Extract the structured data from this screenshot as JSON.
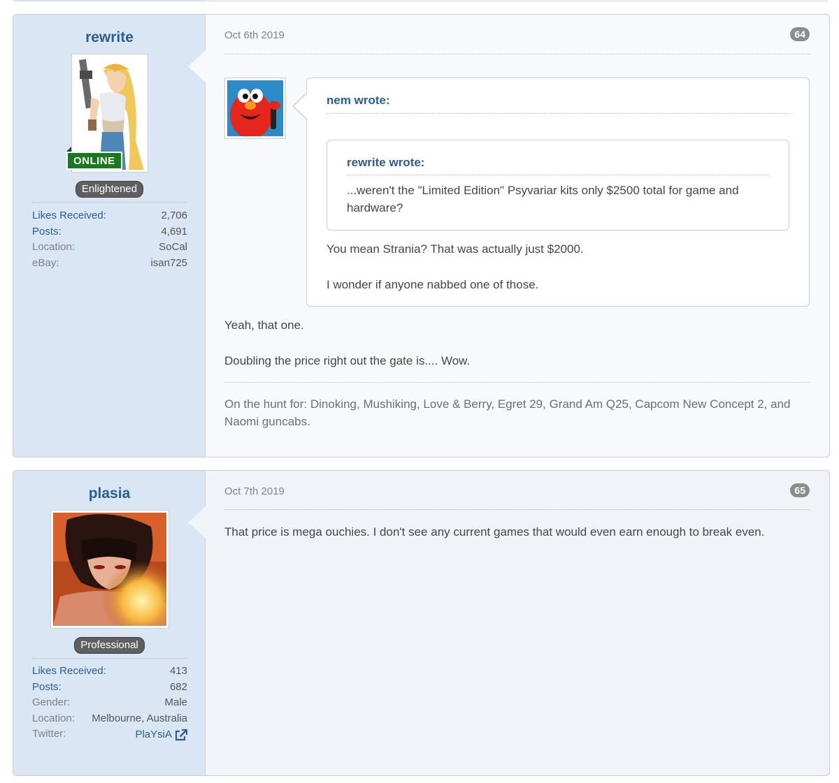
{
  "posts": [
    {
      "username": "rewrite",
      "online_badge": "ONLINE",
      "title": "Enlightened",
      "stats": [
        {
          "label": "Likes Received:",
          "value": "2,706",
          "label_link": true
        },
        {
          "label": "Posts:",
          "value": "4,691",
          "label_link": true
        },
        {
          "label": "Location:",
          "value": "SoCal",
          "label_link": false
        },
        {
          "label": "eBay:",
          "value": "isan725",
          "label_link": false
        }
      ],
      "date": "Oct 6th 2019",
      "number": "64",
      "quote": {
        "author": "nem wrote:",
        "nested": {
          "author": "rewrite wrote:",
          "text": "...weren't the \"Limited Edition\" Psyvariar kits only $2500 total for game and hardware?"
        },
        "lines": [
          "You mean Strania? That was actually just $2000.",
          "I wonder if anyone nabbed one of those."
        ]
      },
      "body": [
        "Yeah, that one.",
        "Doubling the price right out the gate is.... Wow."
      ],
      "signature": "On the hunt for: Dinoking, Mushiking, Love & Berry, Egret 29, Grand Am Q25, Capcom New Concept 2, and Naomi guncabs."
    },
    {
      "username": "plasia",
      "title": "Professional",
      "stats": [
        {
          "label": "Likes Received:",
          "value": "413",
          "label_link": true
        },
        {
          "label": "Posts:",
          "value": "682",
          "label_link": true
        },
        {
          "label": "Gender:",
          "value": "Male",
          "label_link": false
        },
        {
          "label": "Location:",
          "value": "Melbourne, Australia",
          "label_link": false
        }
      ],
      "twitter": {
        "label": "Twitter:",
        "value": "PlaYsiA"
      },
      "date": "Oct 7th 2019",
      "number": "65",
      "body": [
        "That price is mega ouchies. I don't see any current games that would even earn enough to break even."
      ]
    }
  ],
  "icons": {
    "external_link": "external-link-icon"
  },
  "colors": {
    "link": "#2b5e8f",
    "online": "#177a1e",
    "user_panel": "#dae6f4"
  }
}
